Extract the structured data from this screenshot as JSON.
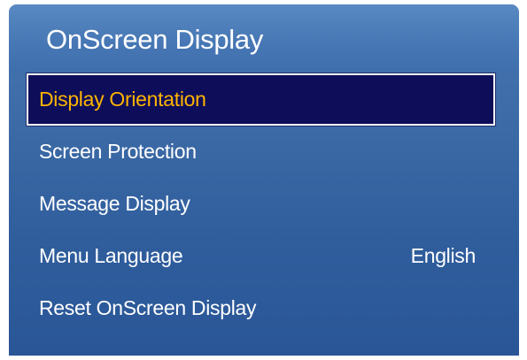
{
  "osd": {
    "title": "OnScreen Display",
    "items": [
      {
        "label": "Display Orientation",
        "value": "",
        "selected": true
      },
      {
        "label": "Screen Protection",
        "value": "",
        "selected": false
      },
      {
        "label": "Message Display",
        "value": "",
        "selected": false
      },
      {
        "label": "Menu Language",
        "value": "English",
        "selected": false
      },
      {
        "label": "Reset OnScreen Display",
        "value": "",
        "selected": false
      }
    ],
    "colors": {
      "panel_blue": "#3c6aa6",
      "selection_bg": "#0d0d5a",
      "selected_text": "#ffb400",
      "text": "#ffffff"
    }
  }
}
